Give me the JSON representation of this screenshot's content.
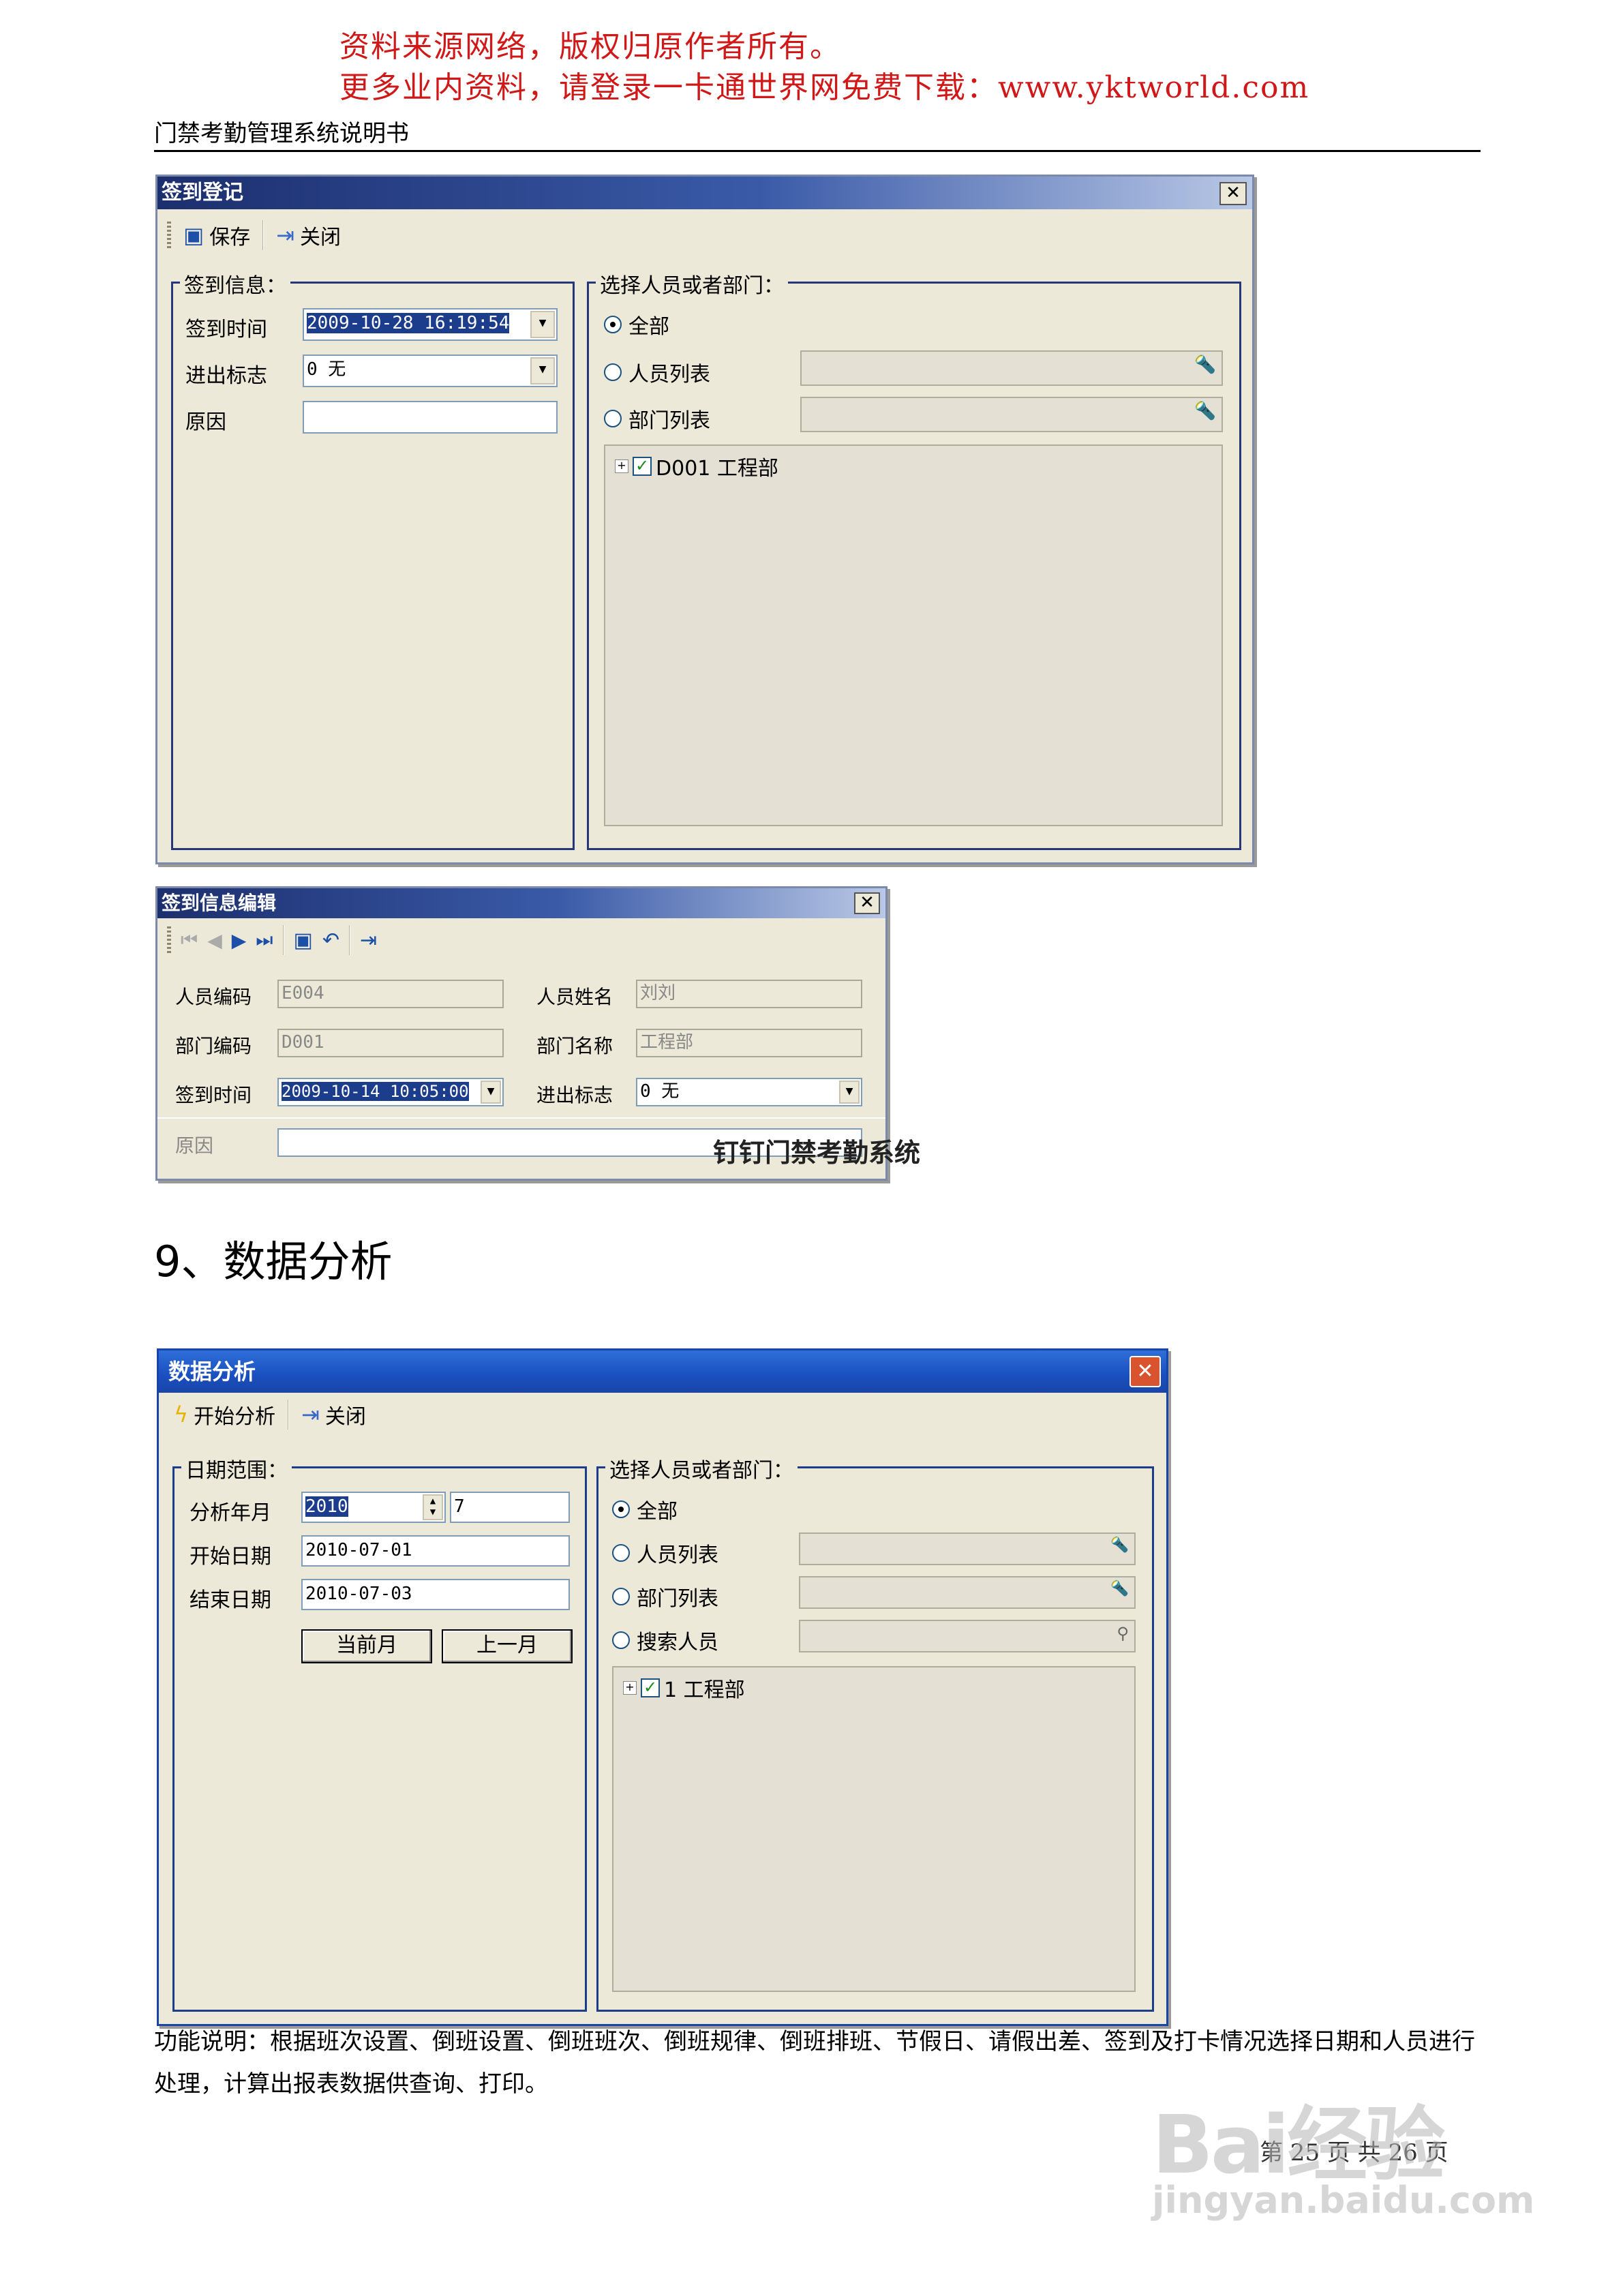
{
  "notice": {
    "line1": "资料来源网络，版权归原作者所有。",
    "line2": "更多业内资料，请登录一卡通世界网免费下载：www.yktworld.com"
  },
  "doc_header": "门禁考勤管理系统说明书",
  "checkin_window": {
    "title": "签到登记",
    "toolbar": {
      "save": "保存",
      "close": "关闭"
    },
    "info_group": {
      "legend": "签到信息：",
      "time_label": "签到时间",
      "time_value": "2009-10-28 16:19:54",
      "flag_label": "进出标志",
      "flag_value": "0 无",
      "reason_label": "原因",
      "reason_value": ""
    },
    "select_group": {
      "legend": "选择人员或者部门：",
      "opt_all": "全部",
      "opt_people": "人员列表",
      "opt_dept": "部门列表",
      "tree_node": "D001  工程部"
    }
  },
  "edit_window": {
    "title": "签到信息编辑",
    "emp_code_label": "人员编码",
    "emp_code_value": "E004",
    "emp_name_label": "人员姓名",
    "emp_name_value": "刘刘",
    "dept_code_label": "部门编码",
    "dept_code_value": "D001",
    "dept_name_label": "部门名称",
    "dept_name_value": "工程部",
    "time_label": "签到时间",
    "time_value": "2009-10-14 10:05:00",
    "flag_label": "进出标志",
    "flag_value": "0 无",
    "reason_label": "原因"
  },
  "stamp_text": "钉钉门禁考勤系统",
  "section_heading": "9、数据分析",
  "analysis_window": {
    "title": "数据分析",
    "toolbar": {
      "start": "开始分析",
      "close": "关闭"
    },
    "date_group": {
      "legend": "日期范围：",
      "month_label": "分析年月",
      "year_value": "2010",
      "month_value": "7",
      "start_label": "开始日期",
      "start_value": "2010-07-01",
      "end_label": "结束日期",
      "end_value": "2010-07-03",
      "btn_current": "当前月",
      "btn_prev": "上一月"
    },
    "select_group": {
      "legend": "选择人员或者部门：",
      "opt_all": "全部",
      "opt_people": "人员列表",
      "opt_dept": "部门列表",
      "opt_search": "搜索人员",
      "tree_node": "1  工程部"
    }
  },
  "description": "功能说明：根据班次设置、倒班设置、倒班班次、倒班规律、倒班排班、节假日、请假出差、签到及打卡情况选择日期和人员进行处理，计算出报表数据供查询、打印。",
  "page_footer": "第 25 页 共 26 页",
  "watermark": {
    "brand": "Bai经验",
    "url": "jingyan.baidu.com"
  }
}
